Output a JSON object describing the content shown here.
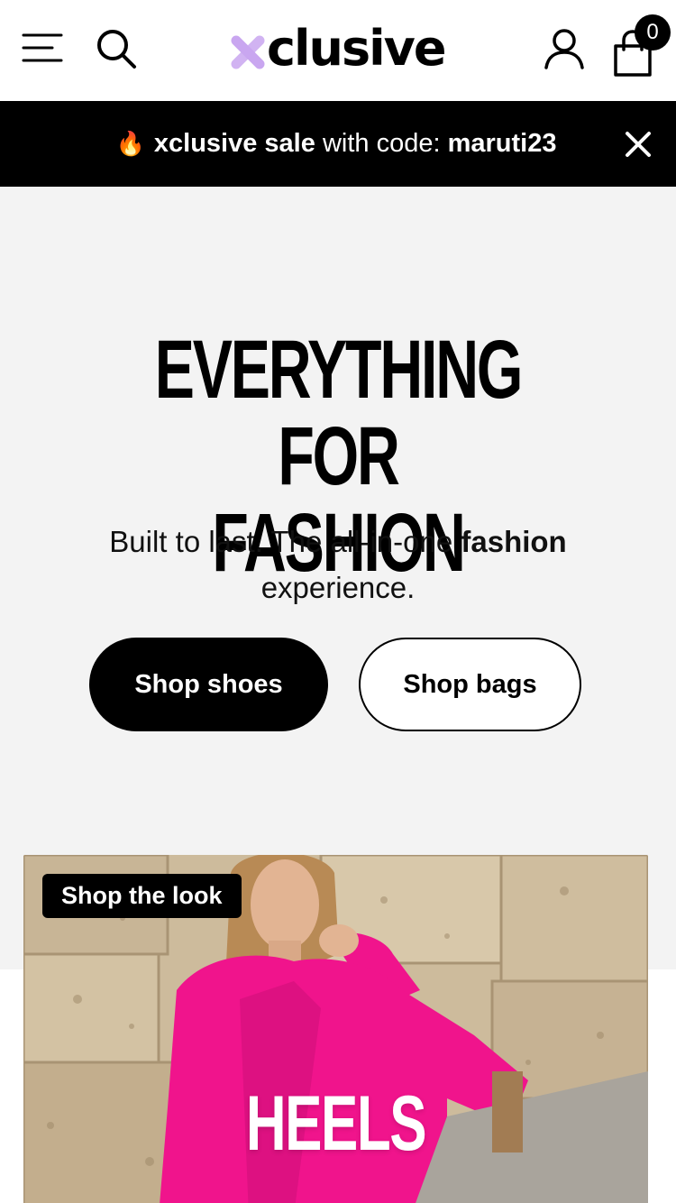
{
  "header": {
    "logo_text": "clusive",
    "cart_count": "0",
    "icons": {
      "menu": "hamburger-menu-icon",
      "search": "search-icon",
      "account": "user-icon",
      "cart": "shopping-bag-icon",
      "logo_mark": "x-logo-mark"
    },
    "logo_mark_color": "#c9a6f0"
  },
  "announcement": {
    "emoji": "🔥",
    "brand": "xclusive sale",
    "text": "with code:",
    "code": "maruti23",
    "close_icon": "close-icon"
  },
  "hero": {
    "title_line1": "EVERYTHING FOR",
    "title_line2": "FASHION",
    "subtitle_start": "Built to last. The all-in-one",
    "subtitle_bold": "fashion",
    "subtitle_end": "experience.",
    "primary_button": "Shop shoes",
    "secondary_button": "Shop bags",
    "background_color": "#f3f3f3"
  },
  "look_card": {
    "badge": "Shop the look",
    "title": "HEELS",
    "accent_color": "#f0148c"
  }
}
